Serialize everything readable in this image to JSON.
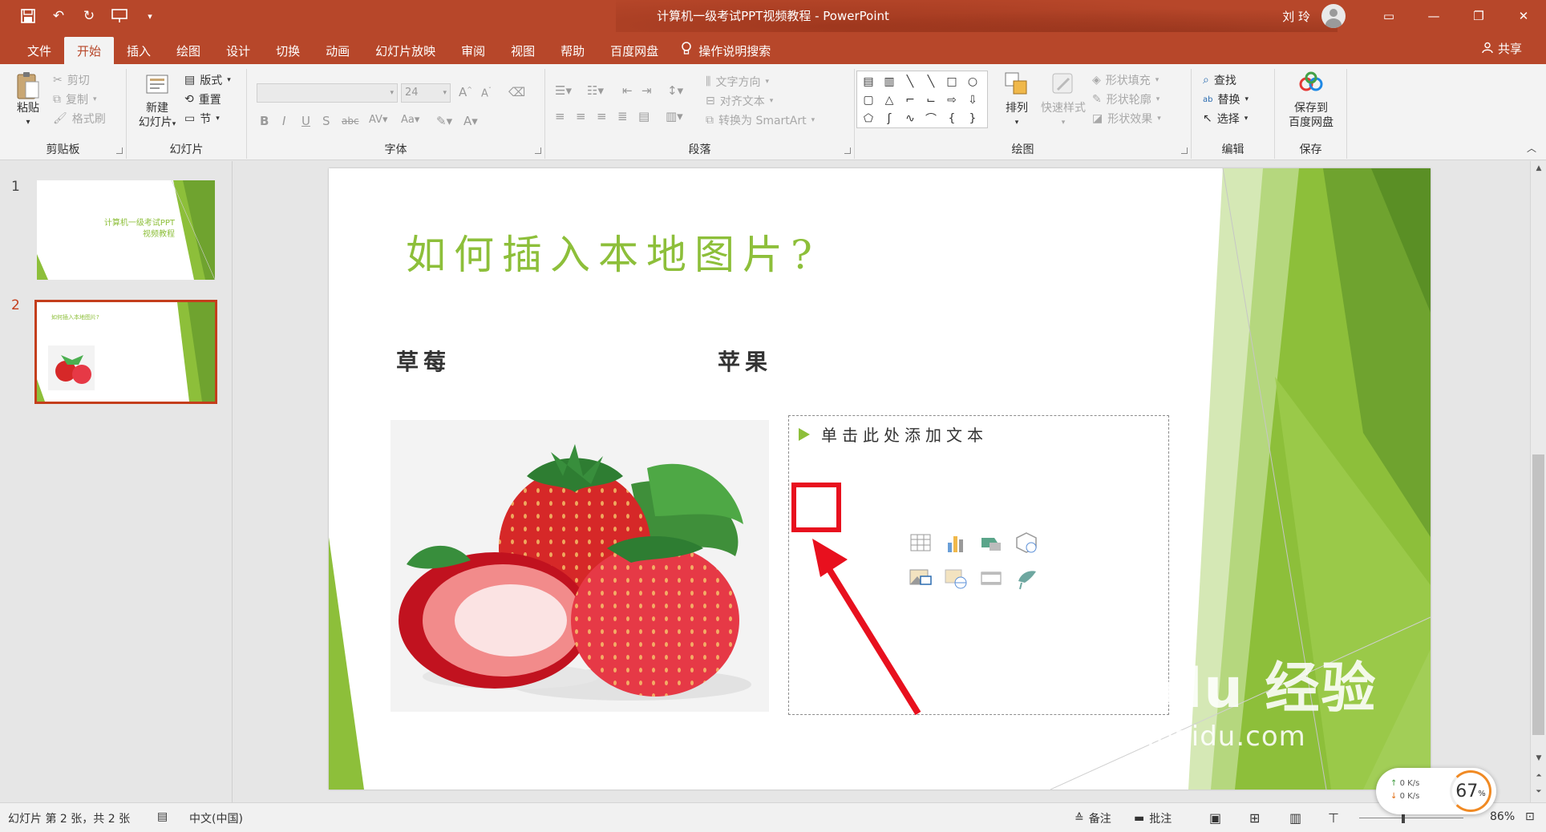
{
  "window": {
    "title": "计算机一级考试PPT视频教程 - PowerPoint",
    "user": "刘 玲"
  },
  "tabs": [
    "文件",
    "开始",
    "插入",
    "绘图",
    "设计",
    "切换",
    "动画",
    "幻灯片放映",
    "审阅",
    "视图",
    "帮助",
    "百度网盘"
  ],
  "active_tab": "开始",
  "tell_me": "操作说明搜索",
  "share": "共享",
  "ribbon": {
    "clipboard": {
      "label": "剪贴板",
      "paste": "粘贴",
      "cut": "剪切",
      "copy": "复制",
      "format_painter": "格式刷"
    },
    "slides": {
      "label": "幻灯片",
      "new_slide_line1": "新建",
      "new_slide_line2": "幻灯片",
      "layout": "版式",
      "reset": "重置",
      "section": "节"
    },
    "font": {
      "label": "字体",
      "size": "24"
    },
    "paragraph": {
      "label": "段落",
      "text_direction": "文字方向",
      "align_text": "对齐文本",
      "convert_smartart": "转换为 SmartArt"
    },
    "drawing": {
      "label": "绘图",
      "arrange": "排列",
      "quick_styles": "快速样式",
      "shape_fill": "形状填充",
      "shape_outline": "形状轮廓",
      "shape_effects": "形状效果"
    },
    "editing": {
      "label": "编辑",
      "find": "查找",
      "replace": "替换",
      "select": "选择"
    },
    "save": {
      "label": "保存",
      "save_to_line1": "保存到",
      "save_to_line2": "百度网盘"
    }
  },
  "thumbnails": [
    {
      "number": "1",
      "title": "计算机一级考试PPT",
      "subtitle": "视频教程"
    },
    {
      "number": "2",
      "title": "如何插入本地图片?"
    }
  ],
  "slide": {
    "title": "如何插入本地图片?",
    "left_label": "草莓",
    "right_label": "苹果",
    "placeholder_text": "单击此处添加文本"
  },
  "status": {
    "slide_info": "幻灯片 第 2 张，共 2 张",
    "language": "中文(中国)",
    "notes": "备注",
    "comments": "批注",
    "zoom": "86%"
  },
  "net_widget": {
    "up_value": "0",
    "down_value": "0",
    "unit": "K/s",
    "percent": "67",
    "percent_sign": "%"
  },
  "watermark": {
    "brand": "Bai du 经验",
    "url": "jingyan.baidu.com"
  }
}
